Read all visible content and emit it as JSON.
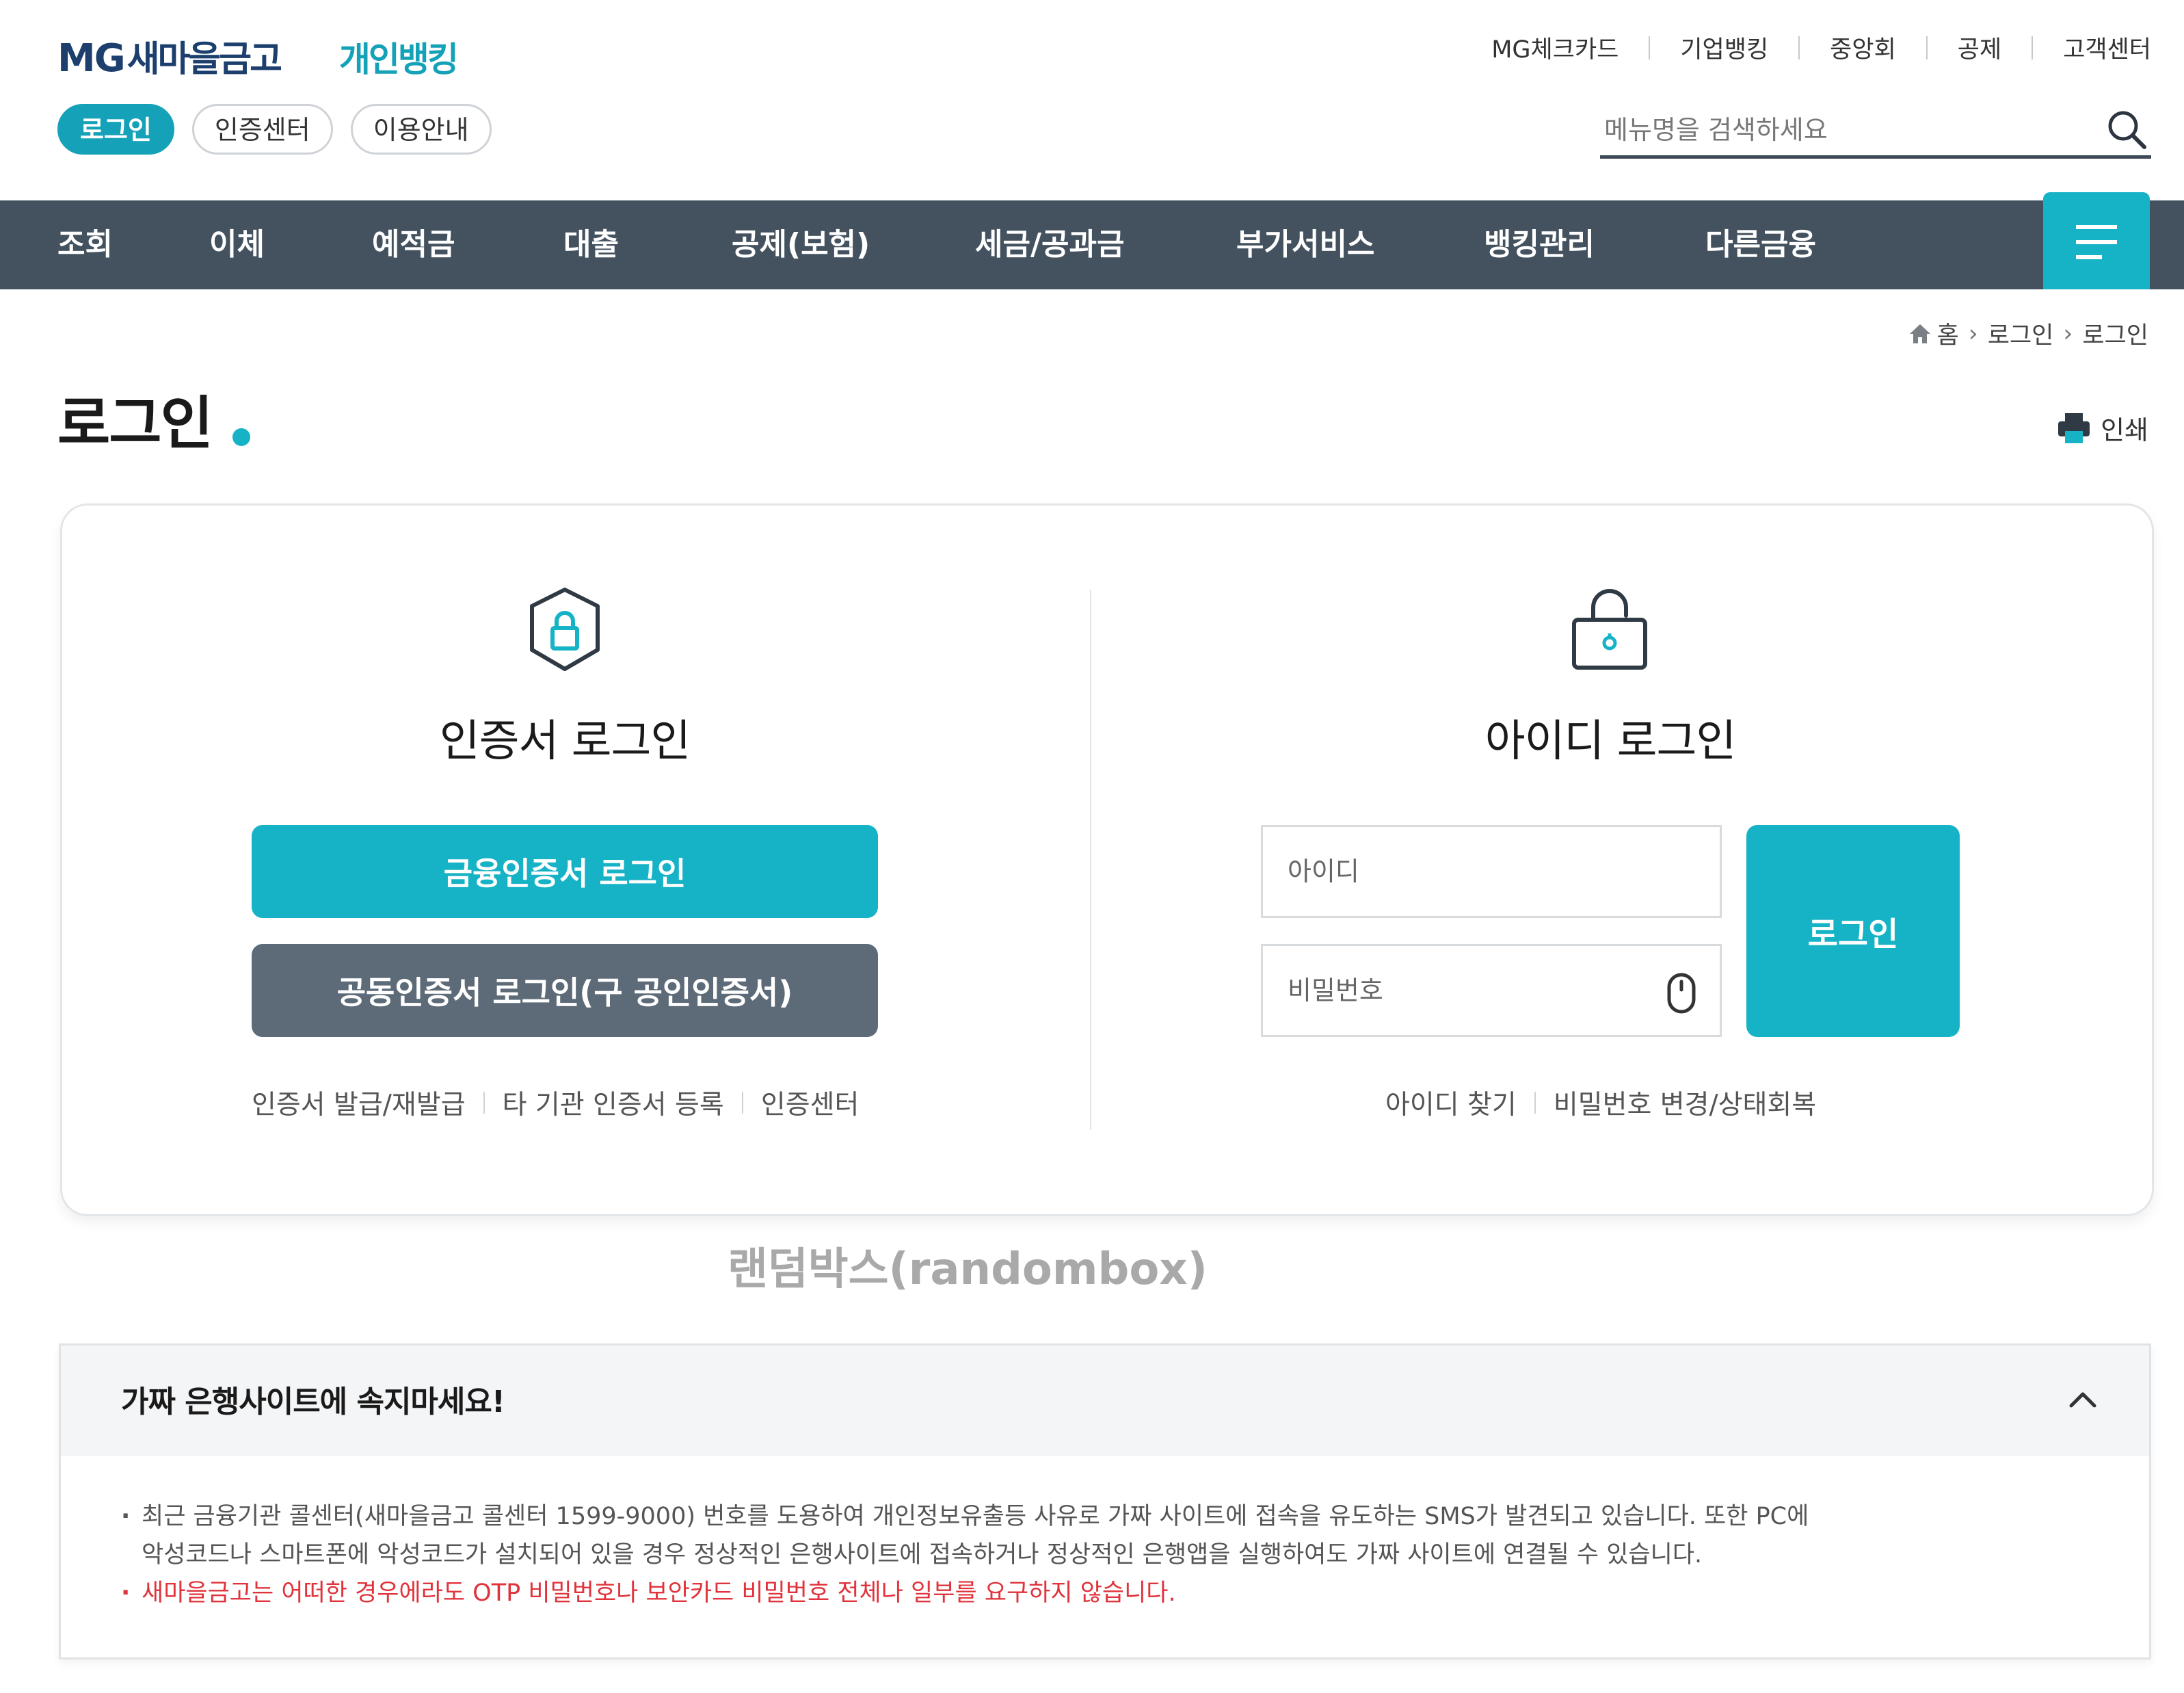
{
  "header": {
    "logo_mg": "MG",
    "logo_brand": "새마을금고",
    "logo_sub": "개인뱅킹",
    "pills": [
      "로그인",
      "인증센터",
      "이용안내"
    ],
    "util_links": [
      "MG체크카드",
      "기업뱅킹",
      "중앙회",
      "공제",
      "고객센터"
    ],
    "search_placeholder": "메뉴명을 검색하세요"
  },
  "gnb": {
    "items": [
      "조회",
      "이체",
      "예적금",
      "대출",
      "공제(보험)",
      "세금/공과금",
      "부가서비스",
      "뱅킹관리",
      "다른금융"
    ]
  },
  "breadcrumb": [
    "홈",
    "로그인",
    "로그인"
  ],
  "page": {
    "title": "로그인",
    "print_label": "인쇄"
  },
  "cert_login": {
    "title": "인증서 로그인",
    "primary_button": "금융인증서 로그인",
    "secondary_button": "공동인증서 로그인(구 공인인증서)",
    "links": [
      "인증서 발급/재발급",
      "타 기관 인증서 등록",
      "인증센터"
    ]
  },
  "id_login": {
    "title": "아이디 로그인",
    "id_placeholder": "아이디",
    "password_placeholder": "비밀번호",
    "login_button": "로그인",
    "links": [
      "아이디 찾기",
      "비밀번호 변경/상태회복"
    ]
  },
  "watermark": "랜덤박스(randombox)",
  "notice": {
    "title": "가짜 은행사이트에 속지마세요!",
    "line1": "최근 금융기관 콜센터(새마을금고 콜센터 1599-9000) 번호를 도용하여 개인정보유출등 사유로 가짜 사이트에 접속을 유도하는 SMS가 발견되고 있습니다. 또한 PC에",
    "line1b": "악성코드나 스마트폰에 악성코드가 설치되어 있을 경우 정상적인 은행사이트에 접속하거나 정상적인 은행앱을 실행하여도 가짜 사이트에 연결될 수 있습니다.",
    "line2": "새마을금고는 어떠한 경우에라도 OTP 비밀번호나 보안카드 비밀번호 전체나 일부를 요구하지 않습니다."
  },
  "colors": {
    "accent": "#16b3c6",
    "nav_bg": "#44525f",
    "secondary_button": "#5d6b78",
    "warning_text": "#e0333b",
    "logo_navy": "#1c3f6e"
  },
  "icons": [
    "search-icon",
    "menu-icon",
    "home-icon",
    "chevron-right-icon",
    "printer-icon",
    "shield-lock-icon",
    "padlock-open-icon",
    "mouse-icon",
    "chevron-up-icon"
  ]
}
